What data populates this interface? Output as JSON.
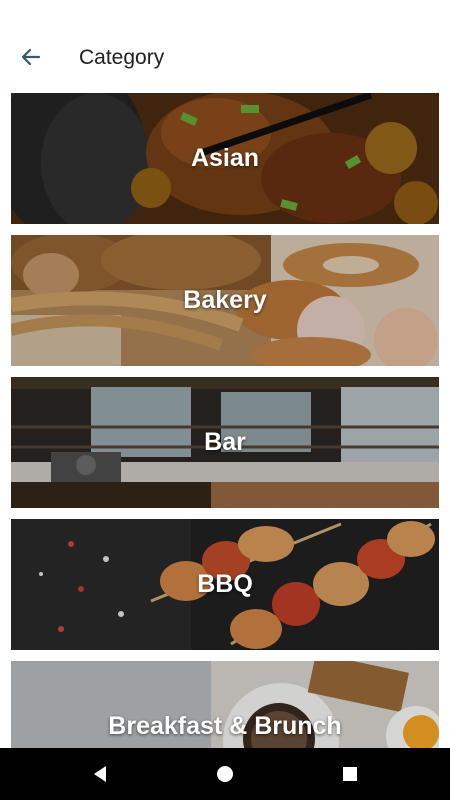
{
  "header": {
    "title": "Category",
    "back_icon": "arrow-left-icon"
  },
  "colors": {
    "back_arrow": "#37596b",
    "title_text": "#212121",
    "card_overlay": "#000000",
    "nav_bar": "#000000"
  },
  "categories": [
    {
      "label": "Asian"
    },
    {
      "label": "Bakery"
    },
    {
      "label": "Bar"
    },
    {
      "label": "BBQ"
    },
    {
      "label": "Breakfast & Brunch"
    }
  ],
  "system_nav": {
    "back_icon": "triangle-back-icon",
    "home_icon": "circle-home-icon",
    "recents_icon": "square-recents-icon"
  }
}
